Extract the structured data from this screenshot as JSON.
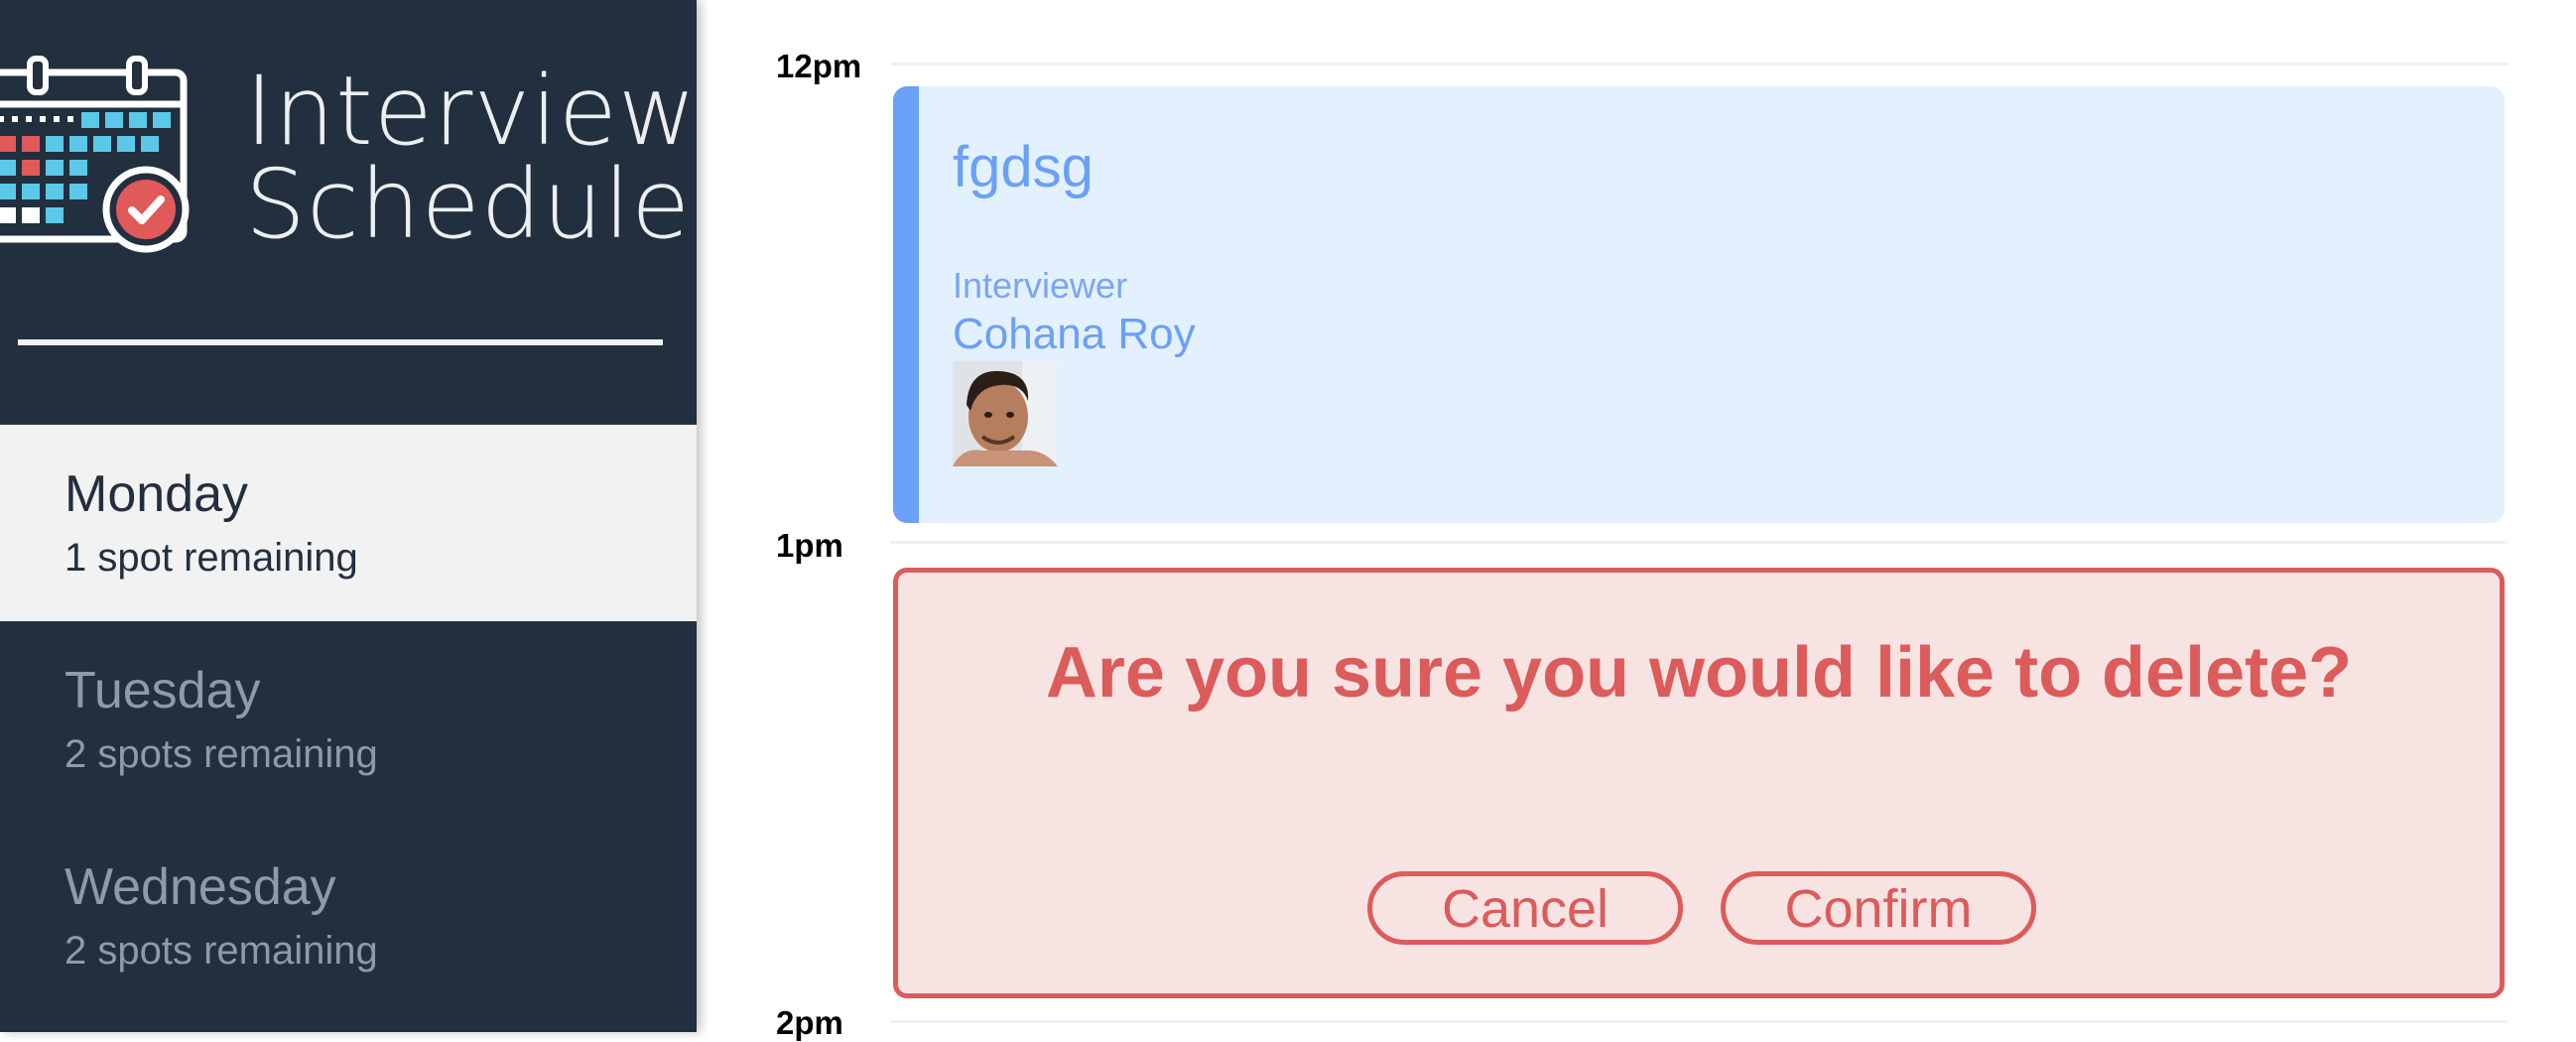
{
  "sidebar": {
    "logo": {
      "line1": "Interview",
      "line2": "Scheduler"
    },
    "days": [
      {
        "name": "Monday",
        "spots": "1 spot remaining",
        "selected": true
      },
      {
        "name": "Tuesday",
        "spots": "2 spots remaining",
        "selected": false
      },
      {
        "name": "Wednesday",
        "spots": "2 spots remaining",
        "selected": false
      }
    ]
  },
  "schedule": {
    "hours": [
      "12pm",
      "1pm",
      "2pm"
    ],
    "appointment": {
      "student": "fgdsg",
      "interviewer_label": "Interviewer",
      "interviewer_name": "Cohana Roy"
    },
    "confirm": {
      "message": "Are you sure you would like to delete?",
      "cancel_label": "Cancel",
      "confirm_label": "Confirm"
    }
  },
  "colors": {
    "sidebar_bg": "#222f3e",
    "appointment_accent": "#6aa0f5",
    "danger": "#dc5b5b"
  }
}
